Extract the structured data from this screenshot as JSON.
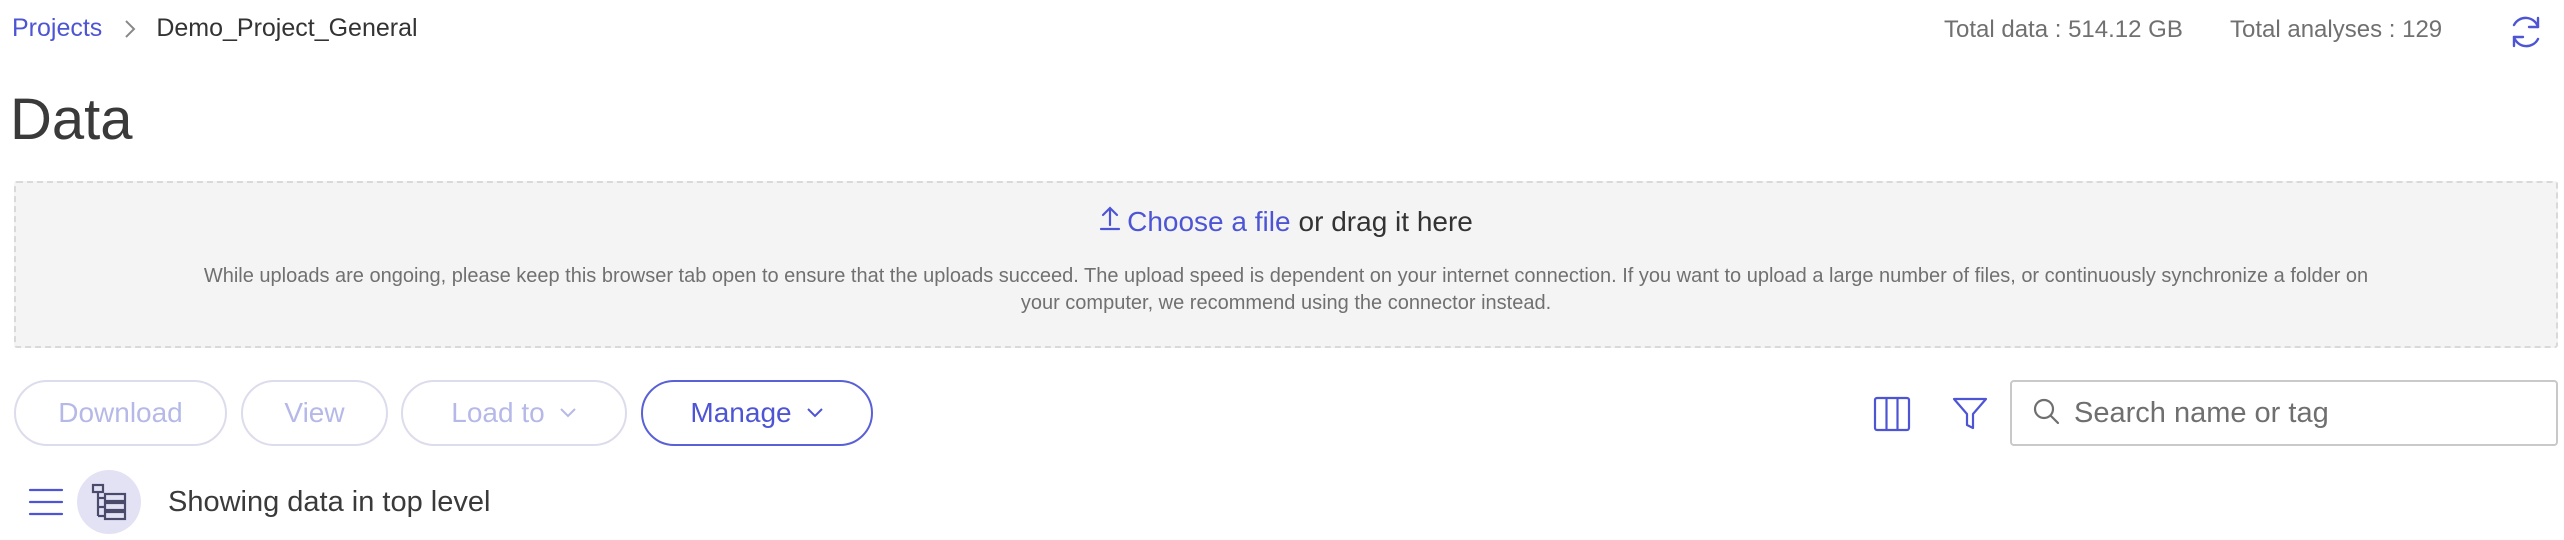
{
  "breadcrumb": {
    "root": "Projects",
    "current": "Demo_Project_General"
  },
  "stats": {
    "total_data": "Total data : 514.12 GB",
    "total_analyses": "Total analyses : 129"
  },
  "page": {
    "title": "Data"
  },
  "upload": {
    "choose_label": "Choose a file",
    "drag_text": "or drag it here",
    "note": "While uploads are ongoing, please keep this browser tab open to ensure that the uploads succeed. The upload speed is dependent on your internet connection. If you want to upload a large number of files, or continuously synchronize a folder on your computer, we recommend using the connector instead."
  },
  "toolbar": {
    "download_label": "Download",
    "view_label": "View",
    "load_to_label": "Load to",
    "manage_label": "Manage"
  },
  "search": {
    "placeholder": "Search name or tag",
    "value": ""
  },
  "listing": {
    "status": "Showing data in top level"
  },
  "icons": {
    "breadcrumb_separator": "chevron-right-icon",
    "refresh": "refresh-icon",
    "upload": "upload-arrow-icon",
    "dropdown": "chevron-down-icon",
    "columns": "columns-icon",
    "filter": "filter-icon",
    "search": "search-icon",
    "list_view": "list-view-icon",
    "tree_view": "tree-view-icon"
  },
  "colors": {
    "accent": "#4e55d4",
    "disabled_text": "#b6b9e8",
    "dropzone_bg": "#f4f4f4",
    "active_toggle_bg": "#e3e2f5"
  }
}
